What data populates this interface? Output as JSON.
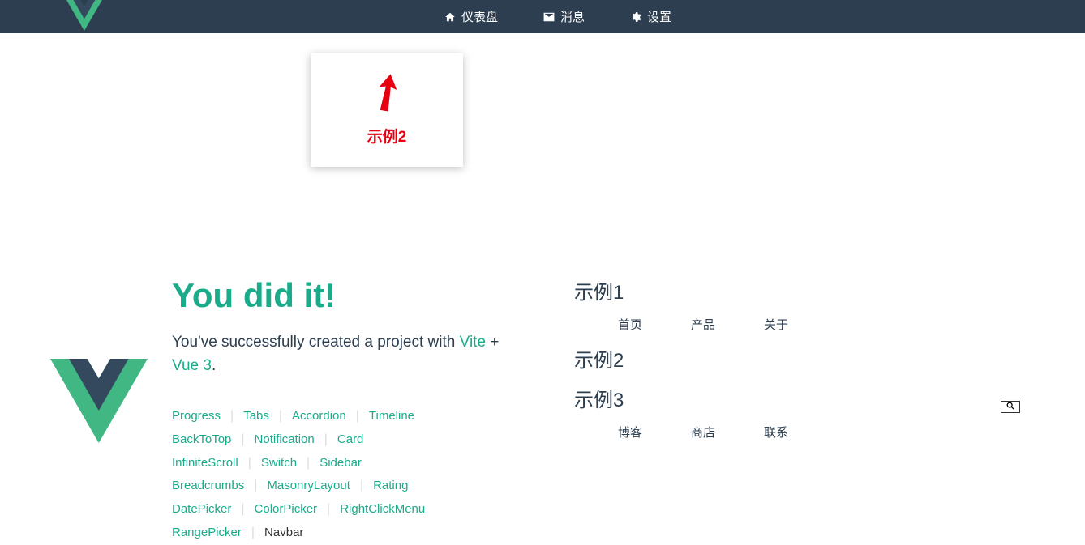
{
  "topnav": {
    "items": [
      {
        "icon": "home",
        "label": "仪表盘"
      },
      {
        "icon": "mail",
        "label": "消息"
      },
      {
        "icon": "gear",
        "label": "设置"
      }
    ]
  },
  "tooltip": {
    "label": "示例2"
  },
  "welcome": {
    "heading": "You did it!",
    "subtext_1": "You've successfully created a project with",
    "vite": "Vite",
    "plus": " + ",
    "vue": "Vue 3",
    "period": "."
  },
  "components": [
    "Progress",
    "Tabs",
    "Accordion",
    "Timeline",
    "BackToTop",
    "Notification",
    "Card",
    "InfiniteScroll",
    "Switch",
    "Sidebar",
    "Breadcrumbs",
    "MasonryLayout",
    "Rating",
    "DatePicker",
    "ColorPicker",
    "RightClickMenu",
    "RangePicker",
    "Navbar"
  ],
  "active_component": "Navbar",
  "examples": {
    "ex1": {
      "title": "示例1",
      "nav": [
        "首页",
        "产品",
        "关于"
      ]
    },
    "ex2": {
      "title": "示例2"
    },
    "ex3": {
      "title": "示例3",
      "nav": [
        "博客",
        "商店",
        "联系"
      ]
    }
  }
}
